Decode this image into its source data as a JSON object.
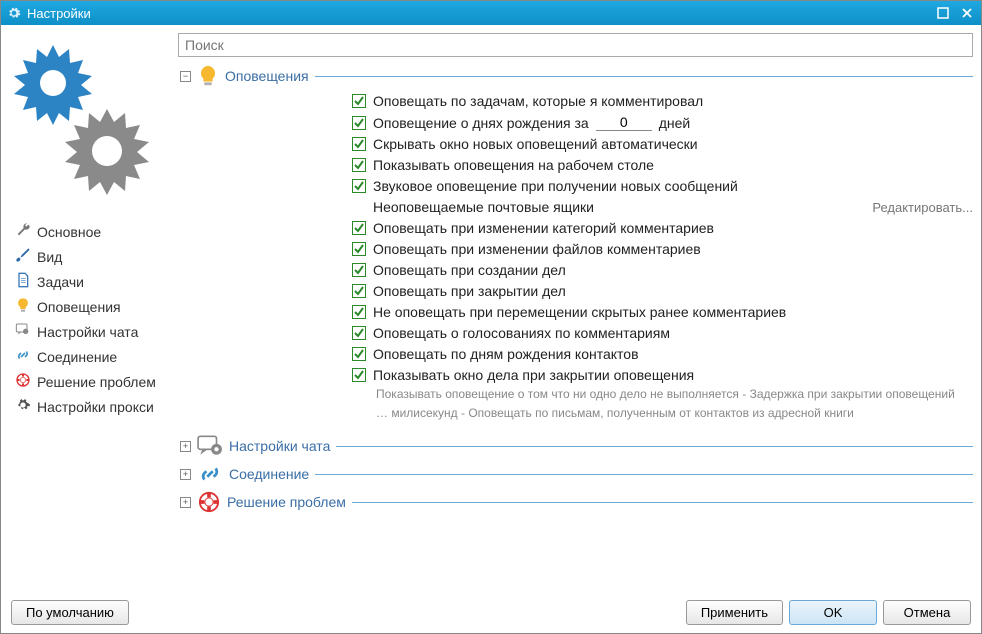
{
  "window": {
    "title": "Настройки"
  },
  "search": {
    "placeholder": "Поиск"
  },
  "sidebar": {
    "items": [
      {
        "label": "Основное",
        "icon": "wrench"
      },
      {
        "label": "Вид",
        "icon": "brush"
      },
      {
        "label": "Задачи",
        "icon": "document"
      },
      {
        "label": "Оповещения",
        "icon": "bulb"
      },
      {
        "label": "Настройки чата",
        "icon": "chat"
      },
      {
        "label": "Соединение",
        "icon": "link"
      },
      {
        "label": "Решение проблем",
        "icon": "lifebuoy"
      },
      {
        "label": "Настройки прокси",
        "icon": "gear"
      }
    ]
  },
  "sections": {
    "notifications": {
      "title": "Оповещения",
      "options": [
        {
          "label": "Оповещать по задачам, которые я комментировал",
          "checked": true
        },
        {
          "label_pre": "Оповещение о днях рождения за",
          "value": "0",
          "label_post": "дней",
          "checked": true,
          "type": "numeric"
        },
        {
          "label": "Скрывать окно новых оповещений автоматически",
          "checked": true
        },
        {
          "label": "Показывать оповещения на рабочем столе",
          "checked": true
        },
        {
          "label": "Звуковое оповещение при получении новых сообщений",
          "checked": true
        },
        {
          "label": "Неоповещаемые почтовые ящики",
          "type": "link",
          "link_label": "Редактировать..."
        },
        {
          "label": "Оповещать при изменении категорий комментариев",
          "checked": true
        },
        {
          "label": "Оповещать при изменении файлов комментариев",
          "checked": true
        },
        {
          "label": "Оповещать при создании дел",
          "checked": true
        },
        {
          "label": "Оповещать при закрытии дел",
          "checked": true
        },
        {
          "label": "Не оповещать при перемещении скрытых ранее комментариев",
          "checked": true
        },
        {
          "label": "Оповещать о голосованиях по комментариям",
          "checked": true
        },
        {
          "label": "Оповещать по дням рождения контактов",
          "checked": true
        },
        {
          "label": "Показывать окно дела при закрытии оповещения",
          "checked": true
        }
      ],
      "description": "Показывать оповещение о том что ни одно дело не выполняется -  Задержка при закрытии оповещений … милисекунд -  Оповещать по письмам, полученным от контактов из адресной книги"
    },
    "chat": {
      "title": "Настройки чата"
    },
    "connection": {
      "title": "Соединение"
    },
    "troubleshoot": {
      "title": "Решение проблем"
    }
  },
  "footer": {
    "default_btn": "По умолчанию",
    "apply_btn": "Применить",
    "ok_btn": "OK",
    "cancel_btn": "Отмена"
  },
  "icons": {
    "minus": "−",
    "plus": "+"
  }
}
